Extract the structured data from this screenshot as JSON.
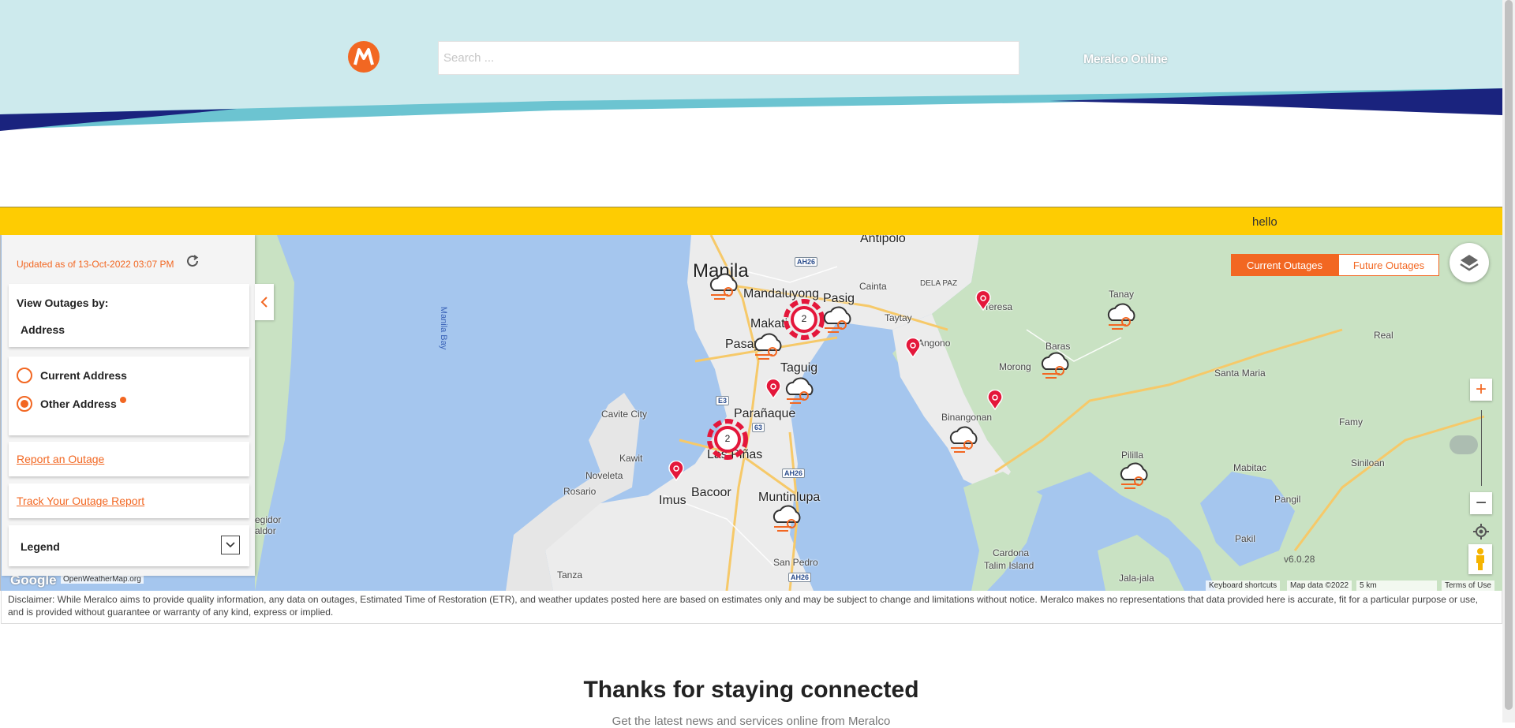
{
  "header": {
    "logo": "meralco-logo-icon",
    "search_placeholder": "Search ...",
    "brand_link": "Meralco Online",
    "colors": {
      "sky": "#cdeaed",
      "teal": "#6cc4d1",
      "navy": "#1a237e"
    }
  },
  "notice": {
    "text": "hello",
    "color": "#fecc02"
  },
  "panel": {
    "updated": "Updated as of 13-Oct-2022 03:07 PM",
    "view_by_title": "View Outages by:",
    "view_by_value": "Address",
    "options": [
      {
        "label": "Current Address",
        "checked": false
      },
      {
        "label": "Other Address",
        "checked": true
      }
    ],
    "report_link": "Report an Outage",
    "track_link": "Track Your Outage Report",
    "legend_label": "Legend",
    "accent": "#f26722"
  },
  "map": {
    "tabs": {
      "current": "Current Outages",
      "future": "Future Outages"
    },
    "places": {
      "manila": "Manila",
      "mandaluyong": "Mandaluyong",
      "pasig": "Pasig",
      "makati": "Makati",
      "pasay": "Pasay",
      "taguig": "Taguig",
      "paranaque": "Parañaque",
      "laspinas": "Las Piñas",
      "bacoor": "Bacoor",
      "imus": "Imus",
      "muntinlupa": "Muntinlupa",
      "antipolo": "Antipolo",
      "cainta": "Cainta",
      "delapaz": "DELA PAZ",
      "taytay": "Taytay",
      "angono": "Angono",
      "teresa": "Teresa",
      "tanay": "Tanay",
      "baras": "Baras",
      "morong": "Morong",
      "binangonan": "Binangonan",
      "santamaria": "Santa Maria",
      "real": "Real",
      "famy": "Famy",
      "siniloan": "Siniloan",
      "mabitac": "Mabitac",
      "pangil": "Pangil",
      "pakil": "Pakil",
      "pililla": "Pililla",
      "cardona": "Cardona",
      "talim": "Talim Island",
      "jalajala": "Jala-jala",
      "cavitecity": "Cavite City",
      "kawit": "Kawit",
      "noveleta": "Noveleta",
      "rosario": "Rosario",
      "tanza": "Tanza",
      "sanpedro": "San Pedro",
      "manilabay": "Manila Bay",
      "egidor": "egidor",
      "aldor": "aldor"
    },
    "roads": [
      "AH26",
      "E3",
      "63",
      "AH26",
      "AH26"
    ],
    "clusters": [
      {
        "count": "2"
      },
      {
        "count": "2"
      }
    ],
    "version": "v6.0.28",
    "google": "Google",
    "owm": "OpenWeatherMap.org",
    "keyboard": "Keyboard shortcuts",
    "mapdata": "Map data ©2022",
    "scale": "5 km",
    "terms": "Terms of Use"
  },
  "disclaimer": "Disclaimer: While Meralco aims to provide quality information, any data on outages, Estimated Time of Restoration (ETR), and weather updates posted here are based on estimates only and may be subject to change and limitations without notice. Meralco makes no representations that data provided here is accurate, fit for a particular purpose or use, and is provided without guarantee or warranty of any kind, express or implied.",
  "thanks": {
    "title": "Thanks for staying connected",
    "subtext": "Get the latest news and services online from Meralco"
  }
}
